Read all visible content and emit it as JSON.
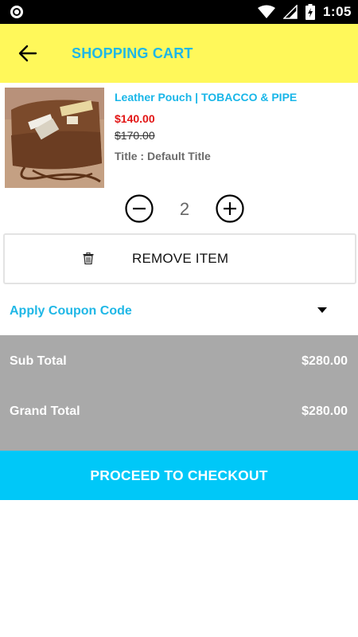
{
  "status_bar": {
    "time": "1:05",
    "battery_level": "charging"
  },
  "toolbar": {
    "title": "SHOPPING CART"
  },
  "cart": {
    "items": [
      {
        "name": "Leather Pouch | TOBACCO & PIPE",
        "price": "$140.00",
        "compare_price": "$170.00",
        "variant": "Title : Default Title",
        "quantity": "2"
      }
    ],
    "remove_label": "REMOVE ITEM"
  },
  "coupon": {
    "label": "Apply Coupon Code"
  },
  "totals": {
    "subtotal_label": "Sub Total",
    "subtotal_value": "$280.00",
    "grand_total_label": "Grand Total",
    "grand_total_value": "$280.00"
  },
  "checkout": {
    "label": "PROCEED TO CHECKOUT"
  },
  "colors": {
    "toolbar_bg": "#fff85a",
    "accent": "#1fb7e6",
    "price": "#e21616",
    "totals_bg": "#a9a9a9",
    "checkout_bg": "#00c8f8"
  },
  "icons": {
    "back": "arrow-left-icon",
    "minus": "minus-circle-icon",
    "plus": "plus-circle-icon",
    "trash": "trash-icon",
    "dropdown": "caret-down-icon"
  }
}
